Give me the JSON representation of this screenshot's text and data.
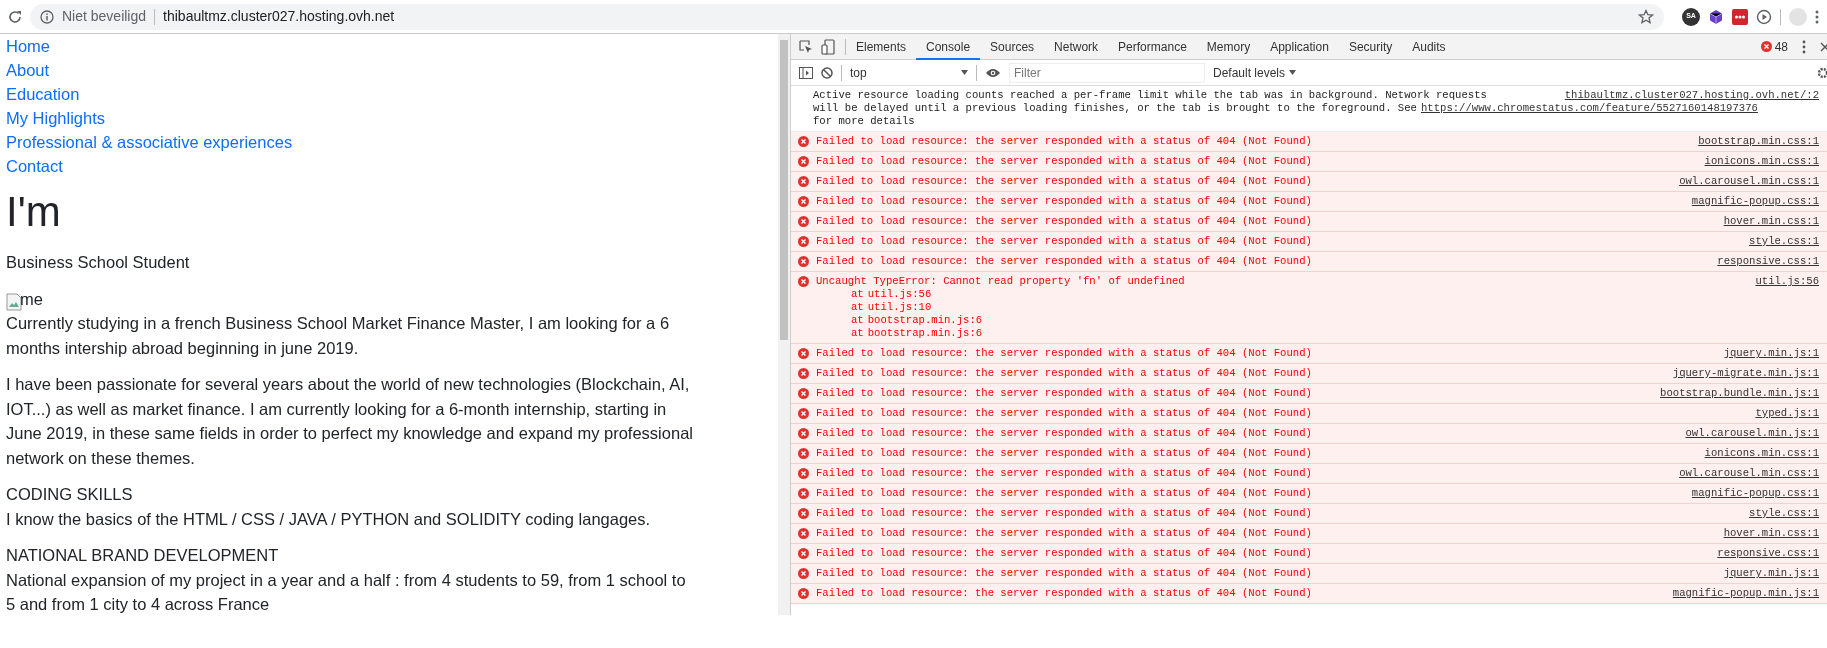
{
  "browser": {
    "security_label": "Niet beveiligd",
    "url": "thibaultmz.cluster027.hosting.ovh.net",
    "extension_badge": "SA"
  },
  "page": {
    "nav": [
      "Home",
      "About",
      "Education",
      "My Highlights",
      "Professional & associative experiences",
      "Contact"
    ],
    "heading": "I'm",
    "subtitle": "Business School Student",
    "image_alt": "me",
    "paragraphs": [
      "Currently studying in a french Business School Market Finance Master, I am looking for a 6 months intership abroad beginning in june 2019.",
      "I have been passionate for several years about the world of new technologies (Blockchain, AI, IOT...) as well as market finance. I am currently looking for a 6-month internship, starting in June 2019, in these same fields in order to perfect my knowledge and expand my professional network on these themes."
    ],
    "sections": [
      {
        "title": "CODING SKILLS",
        "text": "I know the basics of the HTML / CSS / JAVA / PYTHON and SOLIDITY coding langages."
      },
      {
        "title": "NATIONAL BRAND DEVELOPMENT",
        "text": "National expansion of my project in a year and a half : from 4 students to 59, from 1 school to 5 and from 1 city to 4 across France"
      }
    ]
  },
  "devtools": {
    "tabs": [
      {
        "label": "Elements",
        "selected": false
      },
      {
        "label": "Console",
        "selected": true
      },
      {
        "label": "Sources",
        "selected": false
      },
      {
        "label": "Network",
        "selected": false
      },
      {
        "label": "Performance",
        "selected": false
      },
      {
        "label": "Memory",
        "selected": false
      },
      {
        "label": "Application",
        "selected": false
      },
      {
        "label": "Security",
        "selected": false
      },
      {
        "label": "Audits",
        "selected": false
      }
    ],
    "error_count": "48",
    "context": "top",
    "filter_placeholder": "Filter",
    "levels": "Default levels",
    "messages": [
      {
        "kind": "info",
        "text": "Active resource loading counts reached a per-frame limit while the tab was in background. Network requests",
        "text_2": "will be delayed until a previous loading finishes, or the tab is brought to the foreground. See",
        "link": "https://www.chromestatus.com/feature/5527160148197376",
        "text_3": "for more details",
        "source": "thibaultmz.cluster027.hosting.ovh.net/:2"
      },
      {
        "kind": "error",
        "text": "Failed to load resource: the server responded with a status of 404 (Not Found)",
        "source": "bootstrap.min.css:1"
      },
      {
        "kind": "error",
        "text": "Failed to load resource: the server responded with a status of 404 (Not Found)",
        "source": "ionicons.min.css:1"
      },
      {
        "kind": "error",
        "text": "Failed to load resource: the server responded with a status of 404 (Not Found)",
        "source": "owl.carousel.min.css:1"
      },
      {
        "kind": "error",
        "text": "Failed to load resource: the server responded with a status of 404 (Not Found)",
        "source": "magnific-popup.css:1"
      },
      {
        "kind": "error",
        "text": "Failed to load resource: the server responded with a status of 404 (Not Found)",
        "source": "hover.min.css:1"
      },
      {
        "kind": "error",
        "text": "Failed to load resource: the server responded with a status of 404 (Not Found)",
        "source": "style.css:1"
      },
      {
        "kind": "error",
        "text": "Failed to load resource: the server responded with a status of 404 (Not Found)",
        "source": "responsive.css:1"
      },
      {
        "kind": "error",
        "text": "Uncaught TypeError: Cannot read property 'fn' of undefined",
        "source": "util.js:56",
        "stack": [
          {
            "prefix": "at",
            "link": "util.js:56"
          },
          {
            "prefix": "at",
            "link": "util.js:10"
          },
          {
            "prefix": "at",
            "link": "bootstrap.min.js:6"
          },
          {
            "prefix": "at",
            "link": "bootstrap.min.js:6"
          }
        ]
      },
      {
        "kind": "error",
        "text": "Failed to load resource: the server responded with a status of 404 (Not Found)",
        "source": "jquery.min.js:1"
      },
      {
        "kind": "error",
        "text": "Failed to load resource: the server responded with a status of 404 (Not Found)",
        "source": "jquery-migrate.min.js:1"
      },
      {
        "kind": "error",
        "text": "Failed to load resource: the server responded with a status of 404 (Not Found)",
        "source": "bootstrap.bundle.min.js:1"
      },
      {
        "kind": "error",
        "text": "Failed to load resource: the server responded with a status of 404 (Not Found)",
        "source": "typed.js:1"
      },
      {
        "kind": "error",
        "text": "Failed to load resource: the server responded with a status of 404 (Not Found)",
        "source": "owl.carousel.min.js:1"
      },
      {
        "kind": "error",
        "text": "Failed to load resource: the server responded with a status of 404 (Not Found)",
        "source": "ionicons.min.css:1"
      },
      {
        "kind": "error",
        "text": "Failed to load resource: the server responded with a status of 404 (Not Found)",
        "source": "owl.carousel.min.css:1"
      },
      {
        "kind": "error",
        "text": "Failed to load resource: the server responded with a status of 404 (Not Found)",
        "source": "magnific-popup.css:1"
      },
      {
        "kind": "error",
        "text": "Failed to load resource: the server responded with a status of 404 (Not Found)",
        "source": "style.css:1"
      },
      {
        "kind": "error",
        "text": "Failed to load resource: the server responded with a status of 404 (Not Found)",
        "source": "hover.min.css:1"
      },
      {
        "kind": "error",
        "text": "Failed to load resource: the server responded with a status of 404 (Not Found)",
        "source": "responsive.css:1"
      },
      {
        "kind": "error",
        "text": "Failed to load resource: the server responded with a status of 404 (Not Found)",
        "source": "jquery.min.js:1"
      },
      {
        "kind": "error",
        "text": "Failed to load resource: the server responded with a status of 404 (Not Found)",
        "source": "magnific-popup.min.js:1"
      }
    ]
  }
}
